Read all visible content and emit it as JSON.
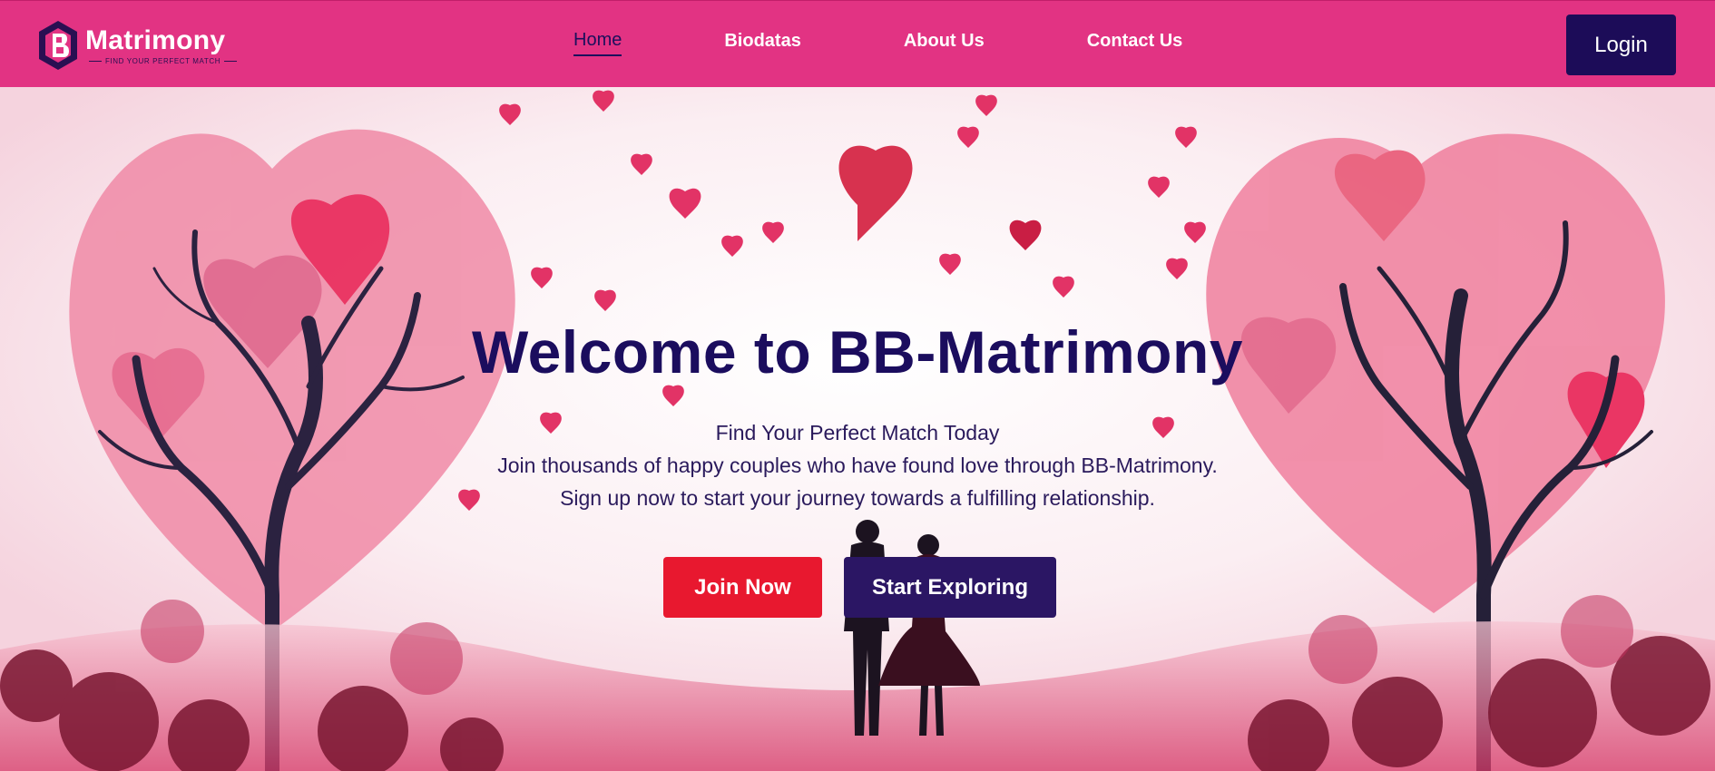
{
  "brand": {
    "name": "Matrimony",
    "tagline": "FIND YOUR PERFECT MATCH"
  },
  "nav": {
    "links": [
      {
        "label": "Home",
        "active": true
      },
      {
        "label": "Biodatas",
        "active": false
      },
      {
        "label": "About Us",
        "active": false
      },
      {
        "label": "Contact Us",
        "active": false
      }
    ],
    "login_label": "Login"
  },
  "hero": {
    "title": "Welcome to BB-Matrimony",
    "lines": [
      "Find Your Perfect Match Today",
      "Join thousands of happy couples who have found love through BB-Matrimony.",
      "Sign up now to start your journey towards a fulfilling relationship."
    ],
    "join_label": "Join Now",
    "explore_label": "Start Exploring"
  },
  "colors": {
    "navbar": "#e23383",
    "navy": "#1c0c58",
    "join_red": "#e8182f",
    "explore_purple": "#2b1664"
  }
}
